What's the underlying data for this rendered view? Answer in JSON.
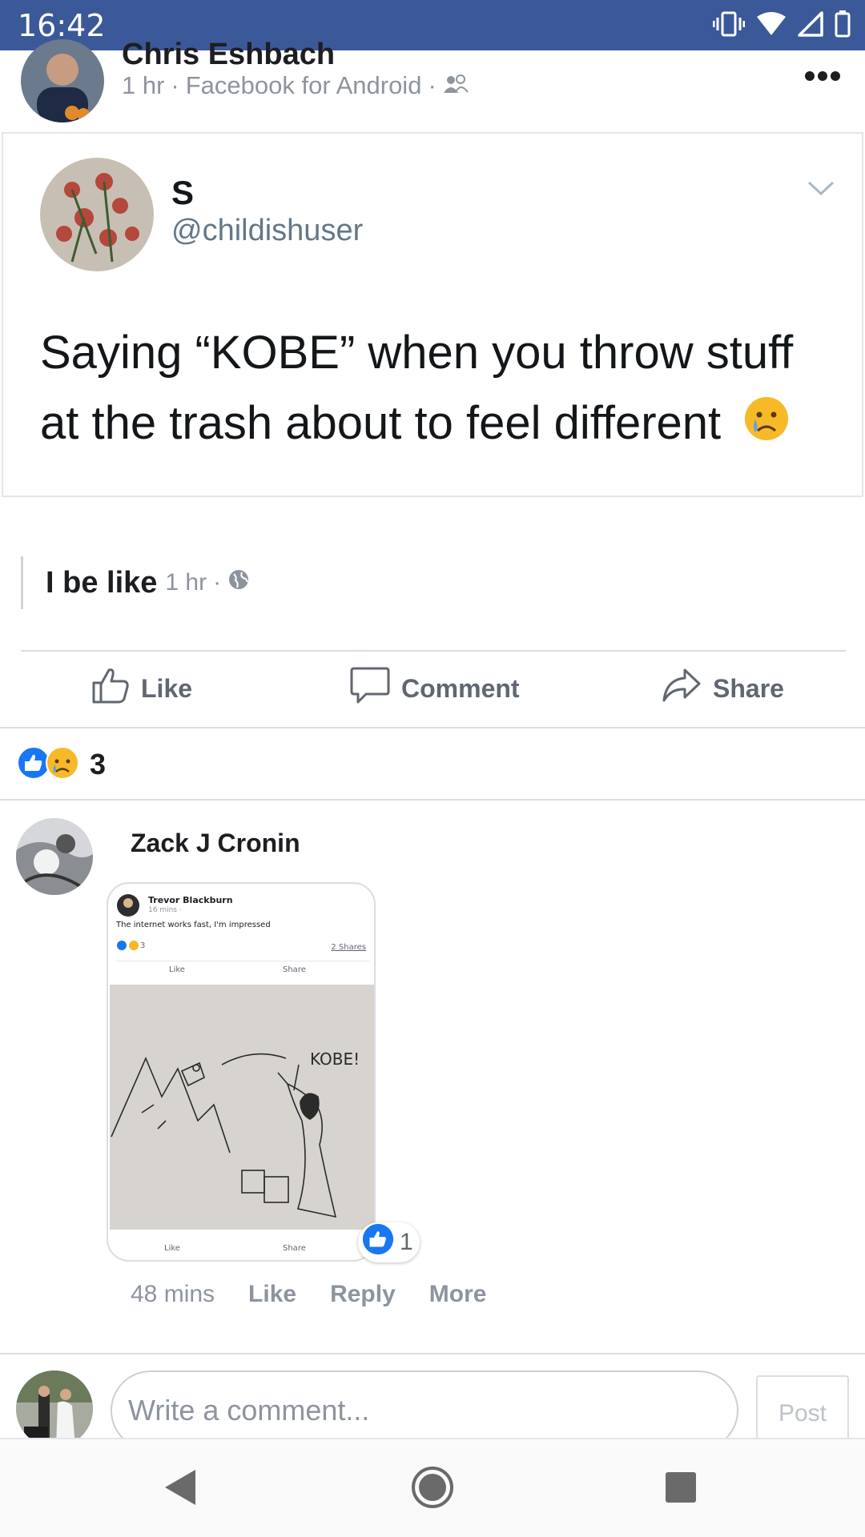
{
  "status_bar": {
    "time": "16:42",
    "icons": [
      "vibrate-icon",
      "wifi-icon",
      "signal-icon",
      "battery-icon"
    ]
  },
  "post": {
    "author_name": "Chris Eshbach",
    "time": "1 hr",
    "source": "Facebook for Android",
    "audience_icon": "friends-icon",
    "more_icon": "more-dots-icon"
  },
  "tweet": {
    "name": "S",
    "handle": "@childishuser",
    "text": "Saying “KOBE” when you throw stuff at the trash about to feel different",
    "emoji": "crying-face-emoji"
  },
  "caption": {
    "title": "I be like",
    "time": "1 hr",
    "privacy_icon": "globe-icon"
  },
  "actions": {
    "like": "Like",
    "comment": "Comment",
    "share": "Share"
  },
  "reactions": {
    "types": [
      "like",
      "sad"
    ],
    "count": "3"
  },
  "comment": {
    "author": "Zack J Cronin",
    "attachment": {
      "poster": "Trevor Blackburn",
      "time": "16 mins ·",
      "text": "The internet works fast, I'm impressed",
      "reaction_count": "3",
      "shares": "2 Shares",
      "like": "Like",
      "share": "Share",
      "drawing_text": "KOBE!"
    },
    "reaction_count": "1",
    "time": "48 mins",
    "like": "Like",
    "reply": "Reply",
    "more": "More"
  },
  "composer": {
    "placeholder": "Write a comment...",
    "post_label": "Post"
  },
  "colors": {
    "brand": "#3b5998",
    "like_blue": "#1877f2",
    "sad_yellow": "#f7b928"
  }
}
